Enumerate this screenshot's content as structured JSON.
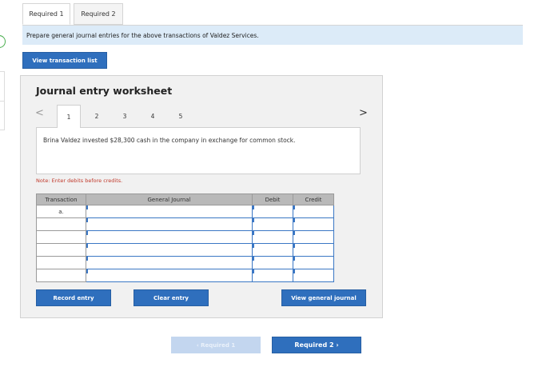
{
  "tabs": [
    {
      "label": "Required 1",
      "active": true
    },
    {
      "label": "Required 2",
      "active": false
    }
  ],
  "instruction": "Prepare general journal entries for the above transactions of Valdez Services.",
  "view_transaction_list": "View transaction list",
  "worksheet": {
    "title": "Journal entry worksheet",
    "prev_arrow": "<",
    "next_arrow": ">",
    "steps": [
      "1",
      "2",
      "3",
      "4",
      "5"
    ],
    "active_step": "1",
    "description": "Brina Valdez invested $28,300 cash in the company in exchange for common stock.",
    "note": "Note: Enter debits before credits.",
    "table": {
      "headers": [
        "Transaction",
        "General Journal",
        "Debit",
        "Credit"
      ],
      "rows": [
        {
          "transaction": "a.",
          "account": "",
          "debit": "",
          "credit": ""
        },
        {
          "transaction": "",
          "account": "",
          "debit": "",
          "credit": ""
        },
        {
          "transaction": "",
          "account": "",
          "debit": "",
          "credit": ""
        },
        {
          "transaction": "",
          "account": "",
          "debit": "",
          "credit": ""
        },
        {
          "transaction": "",
          "account": "",
          "debit": "",
          "credit": ""
        },
        {
          "transaction": "",
          "account": "",
          "debit": "",
          "credit": ""
        }
      ]
    },
    "buttons": {
      "record": "Record entry",
      "clear": "Clear entry",
      "view_journal": "View general journal"
    }
  },
  "footer": {
    "prev_label": "‹  Required 1",
    "next_label": "Required 2  ›"
  },
  "colors": {
    "primary_button": "#2f6fbd",
    "instruction_bg": "#dcebf8",
    "note_text": "#c0392b",
    "disabled_button": "#c3d6ef"
  }
}
